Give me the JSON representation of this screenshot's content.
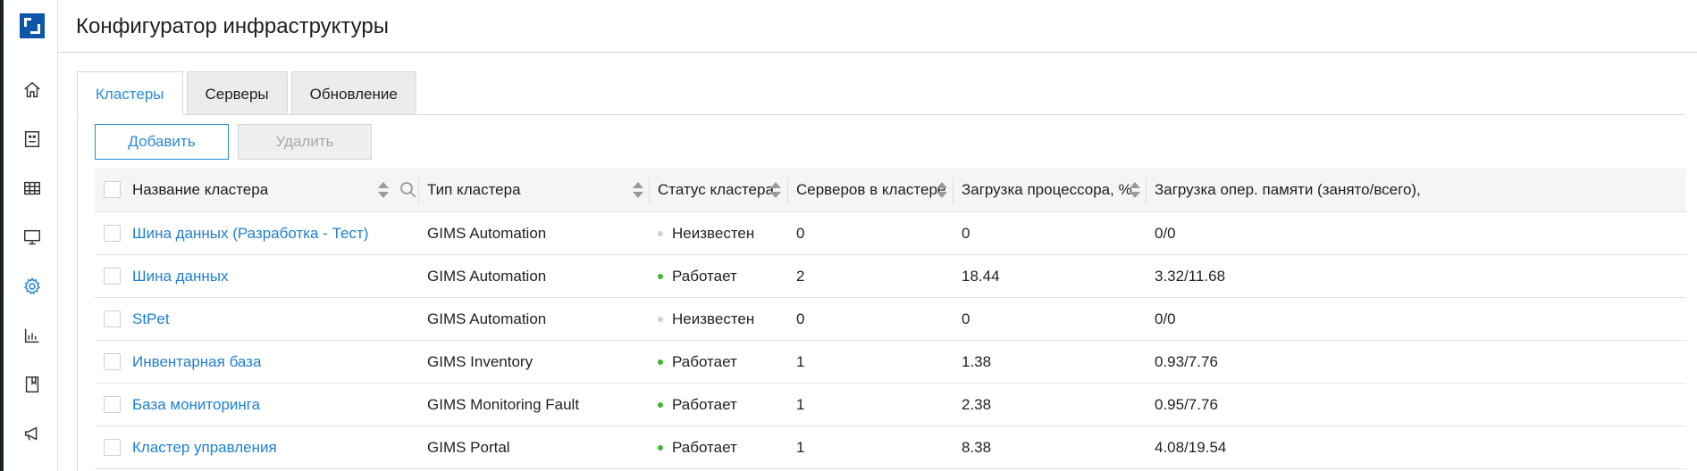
{
  "app": {
    "title": "Конфигуратор инфраструктуры",
    "brand_color": "#0d57a6",
    "accent_color": "#2a8ad8"
  },
  "sidebar": {
    "items": [
      {
        "icon": "home-icon",
        "active": false
      },
      {
        "icon": "id-card-icon",
        "active": false
      },
      {
        "icon": "table-icon",
        "active": false
      },
      {
        "icon": "monitor-icon",
        "active": false
      },
      {
        "icon": "gear-icon",
        "active": true
      },
      {
        "icon": "bar-chart-icon",
        "active": false
      },
      {
        "icon": "bookmark-icon",
        "active": false
      },
      {
        "icon": "megaphone-icon",
        "active": false
      }
    ]
  },
  "tabs": [
    {
      "label": "Кластеры",
      "active": true
    },
    {
      "label": "Серверы",
      "active": false
    },
    {
      "label": "Обновление",
      "active": false
    }
  ],
  "toolbar": {
    "add_label": "Добавить",
    "delete_label": "Удалить"
  },
  "table": {
    "columns": [
      "Название кластера",
      "Тип кластера",
      "Статус кластера",
      "Серверов в кластере",
      "Загрузка процессора, %",
      "Загрузка опер. памяти (занято/всего),"
    ],
    "rows": [
      {
        "name": "Шина данных (Разработка - Тест)",
        "type": "GIMS Automation",
        "status": "Неизвестен",
        "status_color": "#d0d0d0",
        "servers": "0",
        "cpu": "0",
        "mem": "0/0"
      },
      {
        "name": "Шина данных",
        "type": "GIMS Automation",
        "status": "Работает",
        "status_color": "#3cb82a",
        "servers": "2",
        "cpu": "18.44",
        "mem": "3.32/11.68"
      },
      {
        "name": "StPet",
        "type": "GIMS Automation",
        "status": "Неизвестен",
        "status_color": "#d0d0d0",
        "servers": "0",
        "cpu": "0",
        "mem": "0/0"
      },
      {
        "name": "Инвентарная база",
        "type": "GIMS Inventory",
        "status": "Работает",
        "status_color": "#3cb82a",
        "servers": "1",
        "cpu": "1.38",
        "mem": "0.93/7.76"
      },
      {
        "name": "База мониторинга",
        "type": "GIMS Monitoring Fault",
        "status": "Работает",
        "status_color": "#3cb82a",
        "servers": "1",
        "cpu": "2.38",
        "mem": "0.95/7.76"
      },
      {
        "name": "Кластер управления",
        "type": "GIMS Portal",
        "status": "Работает",
        "status_color": "#3cb82a",
        "servers": "1",
        "cpu": "8.38",
        "mem": "4.08/19.54"
      }
    ]
  }
}
